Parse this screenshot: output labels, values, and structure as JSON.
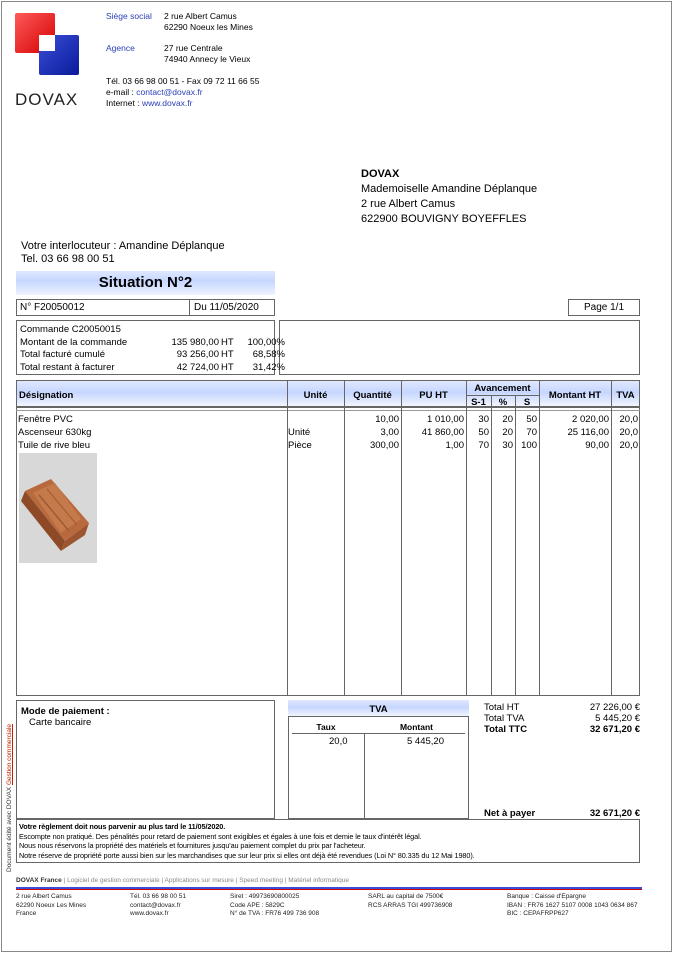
{
  "company": {
    "logo_text": "DOVAX",
    "siege_label": "Siège social",
    "siege_line1": "2 rue Albert Camus",
    "siege_line2": "62290 Noeux les Mines",
    "agence_label": "Agence",
    "agence_line1": "27 rue Centrale",
    "agence_line2": "74940 Annecy le Vieux",
    "tel_fax": "Tél. 03 66 98 00 51 - Fax 09 72 11 66 55",
    "email_label": "e-mail :",
    "email": "contact@dovax.fr",
    "internet_label": "Internet :",
    "website": "www.dovax.fr"
  },
  "recipient": {
    "company": "DOVAX",
    "name": "Mademoiselle Amandine Déplanque",
    "street": "2 rue Albert Camus",
    "city": "622900 BOUVIGNY BOYEFFLES"
  },
  "contact": {
    "line1": "Votre interlocuteur : Amandine Déplanque",
    "line2": "Tel. 03 66 98 00 51"
  },
  "doc": {
    "title": "Situation N°2",
    "number": "N° F20050012",
    "date": "Du 11/05/2020",
    "page": "Page 1/1"
  },
  "summary": {
    "commande": "Commande C20050015",
    "rows": [
      {
        "label": "Montant de la commande",
        "amount": "135 980,00",
        "unit": "HT",
        "pct": "100,00%"
      },
      {
        "label": "Total facturé cumulé",
        "amount": "93 256,00",
        "unit": "HT",
        "pct": "68,58%"
      },
      {
        "label": "Total restant à facturer",
        "amount": "42 724,00",
        "unit": "HT",
        "pct": "31,42%"
      }
    ]
  },
  "table": {
    "headers": {
      "designation": "Désignation",
      "unite": "Unité",
      "quantite": "Quantité",
      "pu_ht": "PU HT",
      "avancement": "Avancement",
      "s1": "S-1",
      "pct": "%",
      "s": "S",
      "montant_ht": "Montant HT",
      "tva": "TVA"
    },
    "rows": [
      {
        "designation": "Fenêtre PVC",
        "unite": "",
        "quantite": "10,00",
        "pu_ht": "1 010,00",
        "s1": "30",
        "pct": "20",
        "s": "50",
        "montant_ht": "2 020,00",
        "tva": "20,0"
      },
      {
        "designation": "Ascenseur 630kg",
        "unite": "Unité",
        "quantite": "3,00",
        "pu_ht": "41 860,00",
        "s1": "50",
        "pct": "20",
        "s": "70",
        "montant_ht": "25 116,00",
        "tva": "20,0"
      },
      {
        "designation": "Tuile de rive bleu",
        "unite": "Pièce",
        "quantite": "300,00",
        "pu_ht": "1,00",
        "s1": "70",
        "pct": "30",
        "s": "100",
        "montant_ht": "90,00",
        "tva": "20,0"
      }
    ]
  },
  "payment": {
    "label": "Mode de paiement :",
    "value": "Carte bancaire"
  },
  "tva_box": {
    "title": "TVA",
    "taux_label": "Taux",
    "montant_label": "Montant",
    "taux": "20,0",
    "montant": "5 445,20"
  },
  "totals": {
    "ht_label": "Total HT",
    "ht": "27 226,00 €",
    "tva_label": "Total TVA",
    "tva": "5 445,20 €",
    "ttc_label": "Total TTC",
    "ttc": "32 671,20 €",
    "net_label": "Net à payer",
    "net": "32 671,20 €"
  },
  "conditions": {
    "line1": "Votre règlement doit nous parvenir au plus tard le 11/05/2020.",
    "line2": "Escompte non pratiqué. Des pénalités pour retard de paiement sont exigibles et égales à une fois et demie le taux d'intérêt légal.",
    "line3": "Nous nous réservons la propriété des matériels et fournitures jusqu'au paiement complet du prix par l'acheteur.",
    "line4": "Notre réserve de propriété porte aussi bien sur les marchandises que sur leur prix si elles ont déjà été revendues (Loi N° 80.335 du 12 Mai 1980)."
  },
  "footer": {
    "brand": "DOVAX France",
    "links": [
      "Logiciel de gestion commerciale",
      "Applications sur mesure",
      "Speed meeting",
      "Matériel informatique"
    ],
    "col1": [
      "2 rue Albert Camus",
      "62290 Noeux Les Mines",
      "France"
    ],
    "col2": [
      "Tél. 03 66 98 00 51",
      "contact@dovax.fr",
      "www.dovax.fr"
    ],
    "col3": [
      "Siret : 49973690800025",
      "Code APE : 5829C",
      "N° de TVA : FR76 499 736 908"
    ],
    "col4": [
      "SARL au capital de 7500€",
      "RCS ARRAS TGI 499736908"
    ],
    "col5": [
      "Banque : Caisse d'Epargne",
      "IBAN : FR76 1627 5107 0008 1043 0634 867",
      "BIC : CEPAFRPP627"
    ]
  },
  "side": {
    "text": "Document édité avec DOVAX",
    "link": "Gestion commerciale"
  },
  "colors": {
    "accent_blue": "#2a3fb6",
    "header_band": "#c6d6ff",
    "logo_red": "#d40000",
    "logo_blue": "#0a1a9a"
  }
}
